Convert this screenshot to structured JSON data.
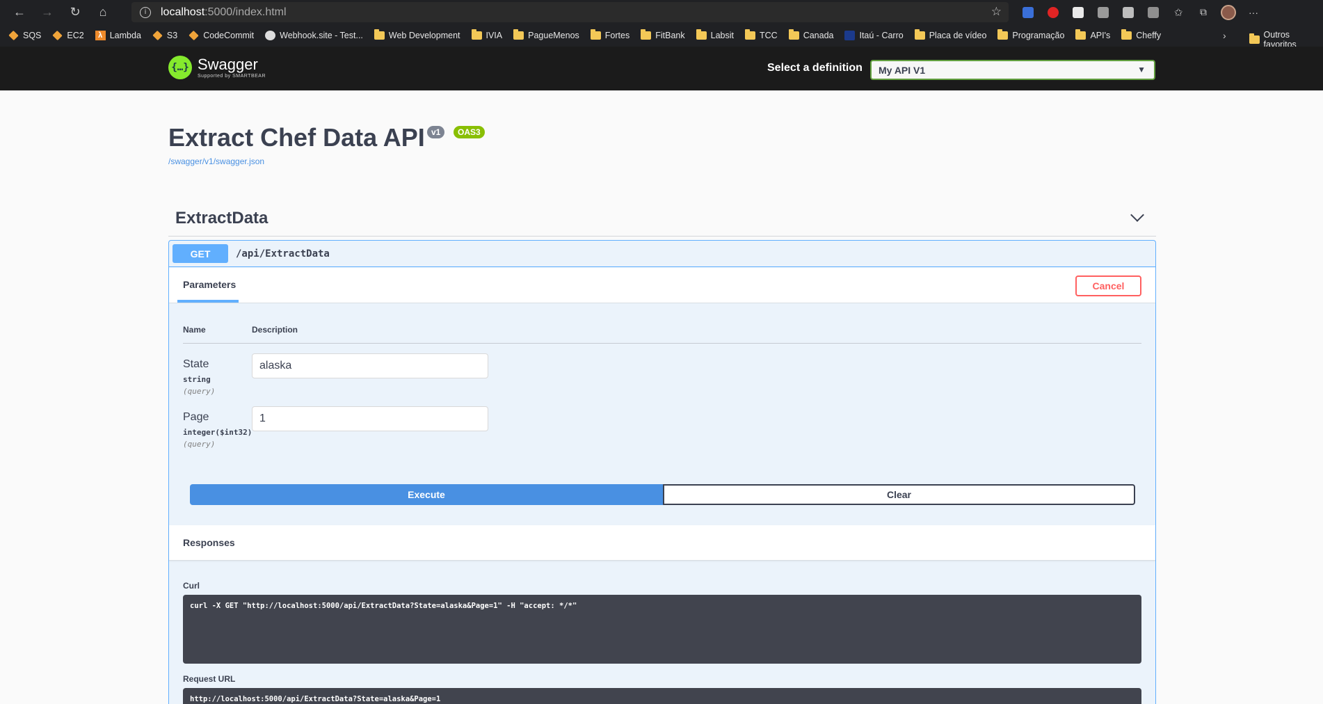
{
  "browser": {
    "url_host": "localhost",
    "url_path": ":5000/index.html"
  },
  "bookmarks": [
    {
      "label": "SQS",
      "icon": "aws-icon"
    },
    {
      "label": "EC2",
      "icon": "aws-icon"
    },
    {
      "label": "Lambda",
      "icon": "lambda-icon"
    },
    {
      "label": "S3",
      "icon": "aws-icon"
    },
    {
      "label": "CodeCommit",
      "icon": "aws-icon"
    },
    {
      "label": "Webhook.site - Test...",
      "icon": "webhook-icon"
    },
    {
      "label": "Web Development",
      "icon": "folder-icon"
    },
    {
      "label": "IVIA",
      "icon": "folder-icon"
    },
    {
      "label": "PagueMenos",
      "icon": "folder-icon"
    },
    {
      "label": "Fortes",
      "icon": "folder-icon"
    },
    {
      "label": "FitBank",
      "icon": "folder-icon"
    },
    {
      "label": "Labsit",
      "icon": "folder-icon"
    },
    {
      "label": "TCC",
      "icon": "folder-icon"
    },
    {
      "label": "Canada",
      "icon": "folder-icon"
    },
    {
      "label": "Itaú - Carro",
      "icon": "itau-icon"
    },
    {
      "label": "Placa de vídeo",
      "icon": "folder-icon"
    },
    {
      "label": "Programação",
      "icon": "folder-icon"
    },
    {
      "label": "API's",
      "icon": "folder-icon"
    },
    {
      "label": "Cheffy",
      "icon": "folder-icon"
    }
  ],
  "other_bookmarks": "Outros favoritos",
  "swagger": {
    "logo_title": "Swagger",
    "logo_sub": "Supported by SMARTBEAR",
    "select_label": "Select a definition",
    "select_value": "My API V1"
  },
  "api": {
    "title": "Extract Chef Data API",
    "version": "v1",
    "oas": "OAS3",
    "spec_url": "/swagger/v1/swagger.json"
  },
  "section": {
    "title": "ExtractData"
  },
  "operation": {
    "method": "GET",
    "path": "/api/ExtractData",
    "params_tab": "Parameters",
    "cancel": "Cancel",
    "col_name": "Name",
    "col_description": "Description",
    "params": [
      {
        "name": "State",
        "type": "string",
        "in": "(query)",
        "value": "alaska"
      },
      {
        "name": "Page",
        "type": "integer($int32)",
        "in": "(query)",
        "value": "1"
      }
    ],
    "execute": "Execute",
    "clear": "Clear"
  },
  "responses": {
    "title": "Responses",
    "curl_label": "Curl",
    "curl": "curl -X GET \"http://localhost:5000/api/ExtractData?State=alaska&Page=1\" -H \"accept: */*\"",
    "request_url_label": "Request URL",
    "request_url": "http://localhost:5000/api/ExtractData?State=alaska&Page=1"
  }
}
